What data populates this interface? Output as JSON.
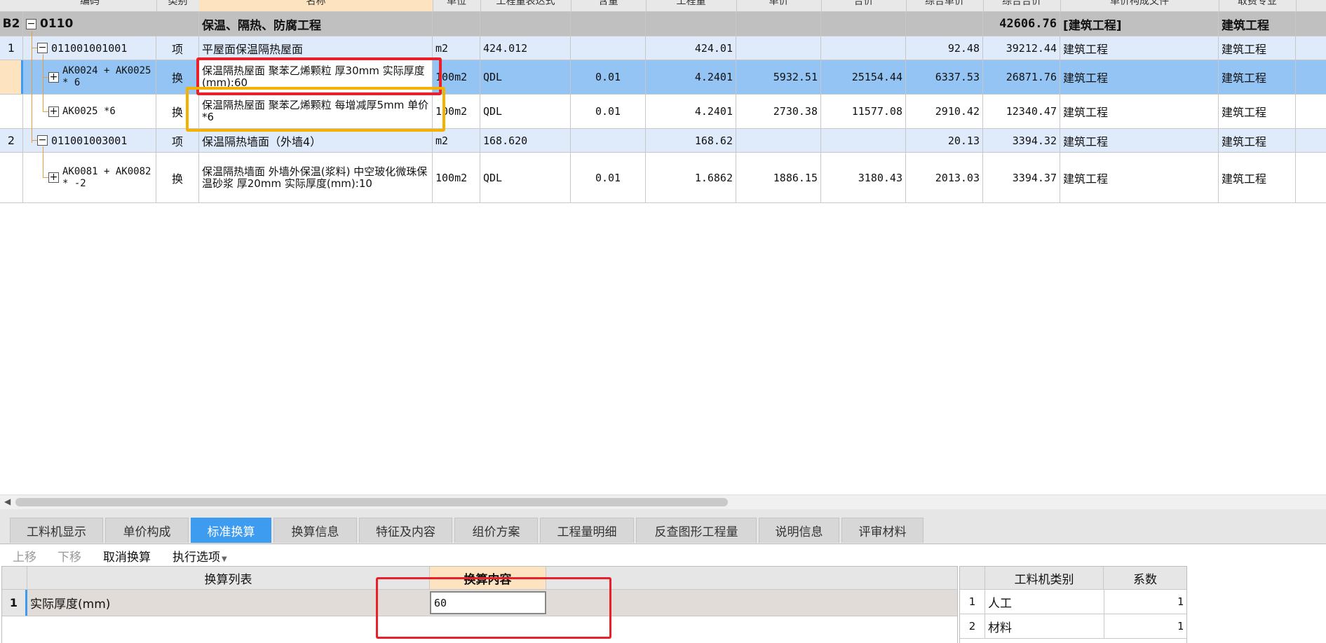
{
  "header_columns": [
    "编码",
    "类别",
    "名称",
    "单位",
    "工程量表达式",
    "含量",
    "工程量",
    "单价",
    "合价",
    "综合单价",
    "综合合价",
    "单价构成文件",
    "取费专业"
  ],
  "group": {
    "index": "B2",
    "code": "0110",
    "name": "保温、隔热、防腐工程",
    "total": "42606.76",
    "cost_file": "[建筑工程]",
    "specialty": "建筑工程"
  },
  "rows": [
    {
      "index": "1",
      "code": "011001001001",
      "type": "项",
      "name": "平屋面保温隔热屋面",
      "unit": "m2",
      "expr": "424.012",
      "content": "",
      "qty": "424.01",
      "price": "",
      "total": "",
      "unit_comp": "92.48",
      "total_comp": "39212.44",
      "cost_file": "建筑工程",
      "specialty": "建筑工程"
    },
    {
      "index": "",
      "code": "AK0024 + AK0025 * 6",
      "type": "换",
      "name": "保温隔热屋面 聚苯乙烯颗粒 厚30mm  实际厚度(mm):60",
      "unit": "100m2",
      "expr": "QDL",
      "content": "0.01",
      "qty": "4.2401",
      "price": "5932.51",
      "total": "25154.44",
      "unit_comp": "6337.53",
      "total_comp": "26871.76",
      "cost_file": "建筑工程",
      "specialty": "建筑工程"
    },
    {
      "index": "",
      "code": "AK0025 *6",
      "type": "换",
      "name": "保温隔热屋面 聚苯乙烯颗粒 每增减厚5mm  单价*6",
      "unit": "100m2",
      "expr": "QDL",
      "content": "0.01",
      "qty": "4.2401",
      "price": "2730.38",
      "total": "11577.08",
      "unit_comp": "2910.42",
      "total_comp": "12340.47",
      "cost_file": "建筑工程",
      "specialty": "建筑工程"
    },
    {
      "index": "2",
      "code": "011001003001",
      "type": "项",
      "name": "保温隔热墙面（外墙4）",
      "unit": "m2",
      "expr": "168.620",
      "content": "",
      "qty": "168.62",
      "price": "",
      "total": "",
      "unit_comp": "20.13",
      "total_comp": "3394.32",
      "cost_file": "建筑工程",
      "specialty": "建筑工程"
    },
    {
      "index": "",
      "code": "AK0081 + AK0082 * -2",
      "type": "换",
      "name": "保温隔热墙面 外墙外保温(浆料) 中空玻化微珠保温砂浆 厚20mm  实际厚度(mm):10",
      "unit": "100m2",
      "expr": "QDL",
      "content": "0.01",
      "qty": "1.6862",
      "price": "1886.15",
      "total": "3180.43",
      "unit_comp": "2013.03",
      "total_comp": "3394.37",
      "cost_file": "建筑工程",
      "specialty": "建筑工程"
    }
  ],
  "tabs": [
    "工料机显示",
    "单价构成",
    "标准换算",
    "换算信息",
    "特征及内容",
    "组价方案",
    "工程量明细",
    "反查图形工程量",
    "说明信息",
    "评审材料"
  ],
  "active_tab": "标准换算",
  "toolbar": {
    "up": "上移",
    "down": "下移",
    "cancel": "取消换算",
    "exec": "执行选项"
  },
  "conversion": {
    "col_list": "换算列表",
    "col_content": "换算内容",
    "rows": [
      {
        "index": "1",
        "label": "实际厚度(mm)",
        "value": "60"
      }
    ]
  },
  "coefficients": {
    "col_type": "工料机类别",
    "col_coef": "系数",
    "rows": [
      {
        "index": "1",
        "type": "人工",
        "coef": "1"
      },
      {
        "index": "2",
        "type": "材料",
        "coef": "1"
      }
    ]
  },
  "colors": {
    "selected_row": "#93c4f3",
    "item_row": "#dfeafb",
    "group_row": "#c0c0c0",
    "active_tab": "#3d9bf0",
    "red_box": "#e8202a",
    "yellow_box": "#f5b100"
  }
}
